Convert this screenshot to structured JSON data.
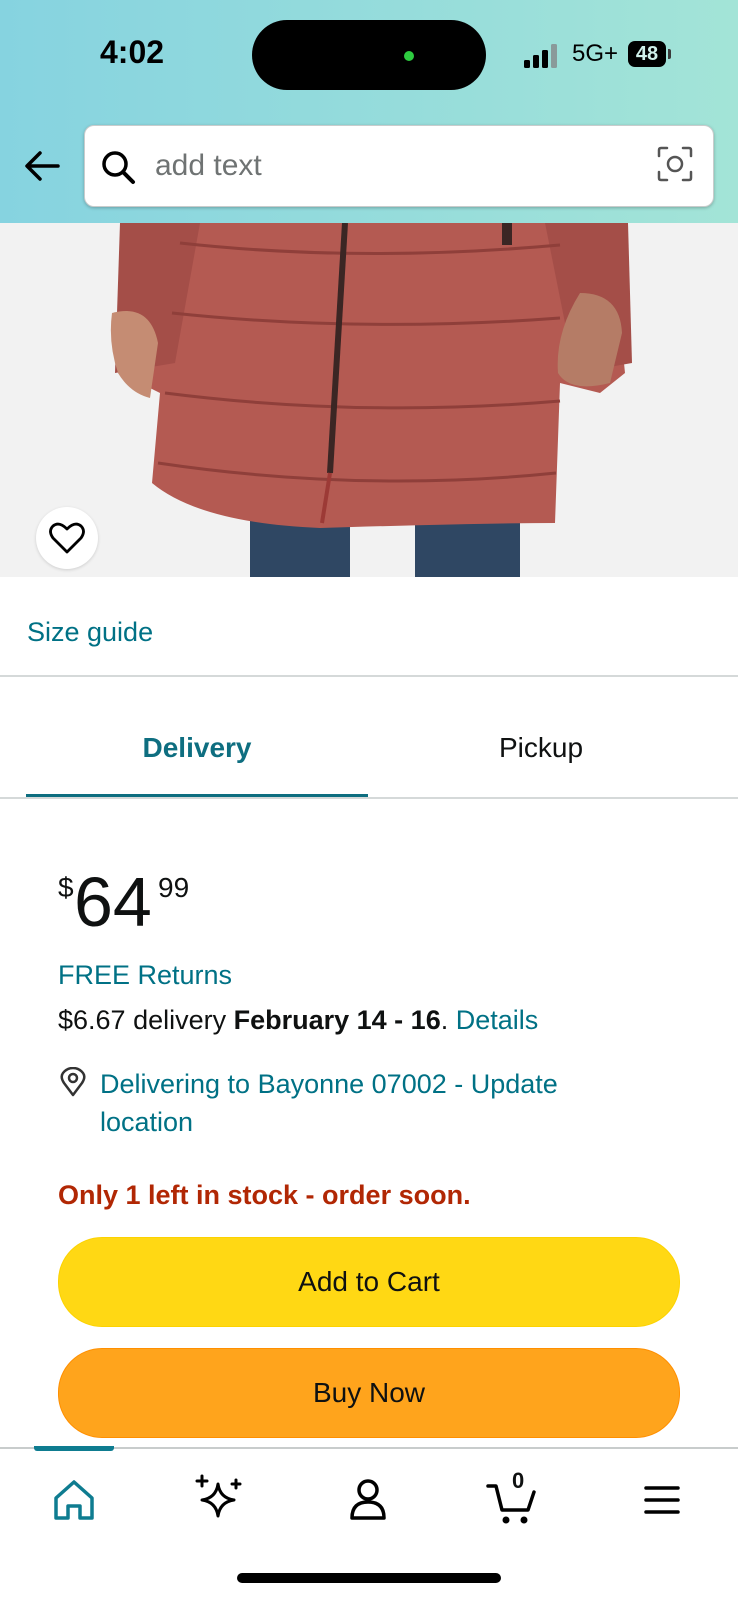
{
  "status_bar": {
    "time": "4:02",
    "network": "5G+",
    "battery": "48"
  },
  "search": {
    "placeholder": "add text",
    "value": ""
  },
  "product": {
    "size_guide": "Size guide"
  },
  "tabs": {
    "delivery": "Delivery",
    "pickup": "Pickup"
  },
  "price": {
    "symbol": "$",
    "whole": "64",
    "fraction": "99"
  },
  "delivery": {
    "free_returns": "FREE Returns",
    "fee": "$6.67 delivery ",
    "dates": "February 14 - 16",
    "period": ". ",
    "details_link": "Details",
    "location": "Delivering to Bayonne 07002 - Update location"
  },
  "stock_message": "Only 1 left in stock - order soon.",
  "buttons": {
    "add_to_cart": "Add to Cart",
    "buy_now": "Buy Now"
  },
  "nav": {
    "cart_count": "0"
  },
  "colors": {
    "link": "#007185",
    "tab_active": "#0e6e80",
    "stock_warning": "#b12704",
    "add_to_cart": "#ffd814",
    "buy_now": "#ffa41c"
  }
}
